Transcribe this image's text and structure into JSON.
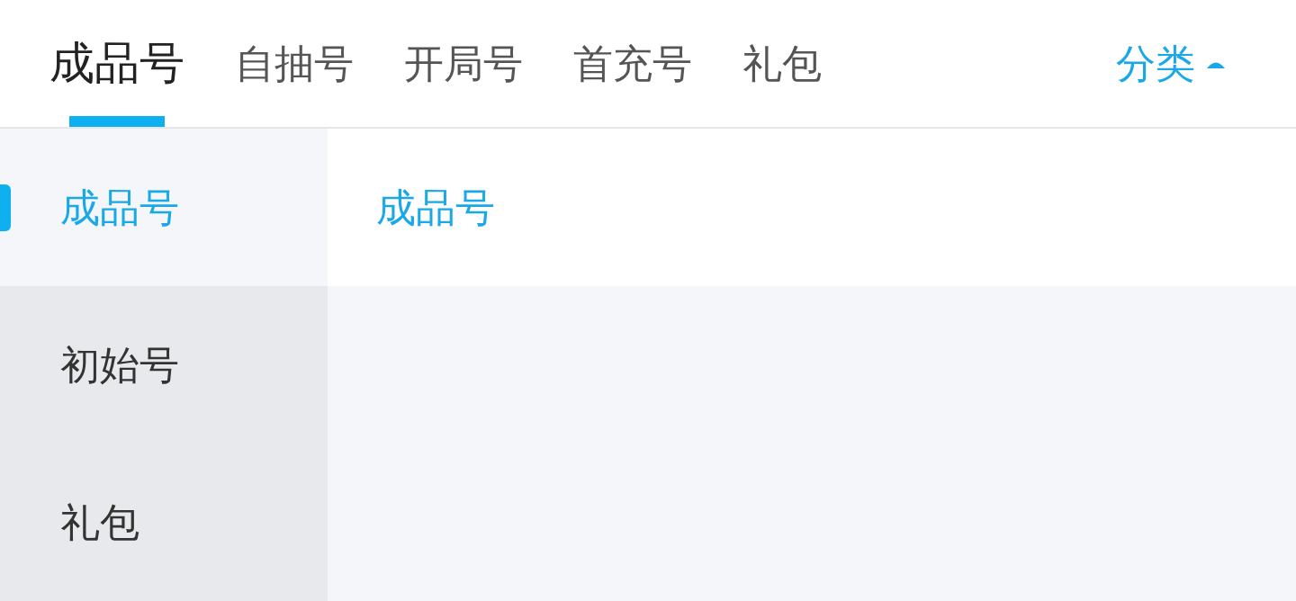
{
  "tabs": [
    {
      "label": "成品号",
      "selected": true
    },
    {
      "label": "自抽号",
      "selected": false
    },
    {
      "label": "开局号",
      "selected": false
    },
    {
      "label": "首充号",
      "selected": false
    },
    {
      "label": "礼包",
      "selected": false
    }
  ],
  "category_toggle": {
    "label": "分类",
    "expanded": true
  },
  "sidebar": {
    "items": [
      {
        "label": "成品号",
        "selected": true
      },
      {
        "label": "初始号",
        "selected": false
      },
      {
        "label": "礼包",
        "selected": false
      }
    ]
  },
  "content": {
    "section_title": "成品号"
  }
}
